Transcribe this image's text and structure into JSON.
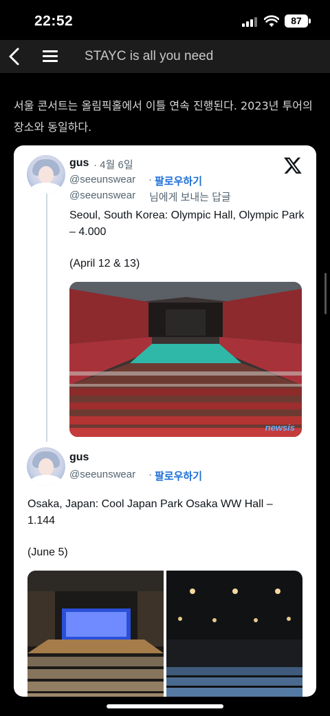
{
  "status_bar": {
    "time": "22:52",
    "battery": "87"
  },
  "nav": {
    "title": "STAYC is all you need",
    "back_icon": "chevron-left-icon",
    "menu_icon": "hamburger-menu-icon"
  },
  "article": {
    "paragraph": "서울 콘서트는 올림픽홀에서 이틀 연속 진행된다. 2023년 투어의 장소와 동일하다."
  },
  "tweet1": {
    "name": "gus",
    "date": "· 4월 6일",
    "handle": "@seeunswear",
    "follow": "팔로우하기",
    "reply_to_handle": "@seeunswear",
    "reply_suffix": "님에게 보내는 답글",
    "text1": "Seoul, South Korea: Olympic Hall, Olympic Park – 4.000",
    "text2": "(April 12 & 13)",
    "photo_watermark": "newsis"
  },
  "tweet2": {
    "name": "gus",
    "handle": "@seeunswear",
    "follow": "팔로우하기",
    "text1": "Osaka, Japan: Cool Japan Park Osaka WW Hall – 1.144",
    "text2": "(June 5)"
  },
  "colors": {
    "follow": "#1d6fd6",
    "card_bg": "#ffffff",
    "nav_bg": "#1c1c1c"
  }
}
